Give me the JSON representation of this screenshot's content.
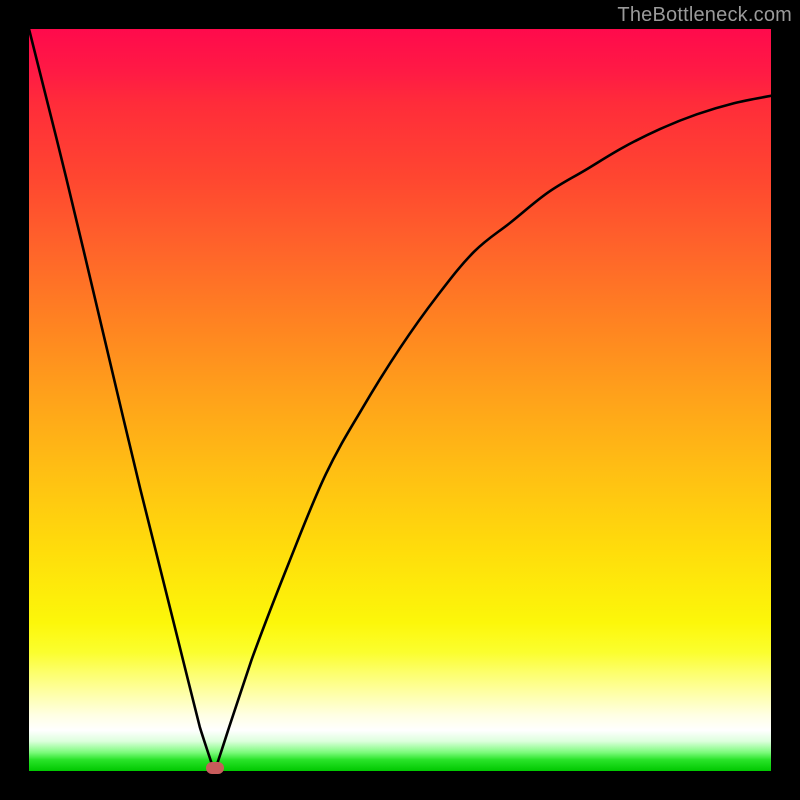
{
  "watermark": {
    "text": "TheBottleneck.com"
  },
  "colors": {
    "frame": "#000000",
    "curve": "#000000",
    "marker": "#c85c5c",
    "gradient_top": "#ff0a4c",
    "gradient_bottom": "#00c800"
  },
  "chart_data": {
    "type": "line",
    "title": "",
    "xlabel": "",
    "ylabel": "",
    "xlim": [
      0,
      100
    ],
    "ylim": [
      0,
      100
    ],
    "series": [
      {
        "name": "bottleneck-curve",
        "x": [
          0,
          5,
          10,
          15,
          20,
          23,
          25,
          27,
          30,
          35,
          40,
          45,
          50,
          55,
          60,
          65,
          70,
          75,
          80,
          85,
          90,
          95,
          100
        ],
        "values": [
          100,
          80,
          59,
          38,
          18,
          6,
          0,
          6,
          15,
          28,
          40,
          49,
          57,
          64,
          70,
          74,
          78,
          81,
          84,
          86.5,
          88.5,
          90,
          91
        ]
      }
    ],
    "marker": {
      "x": 25,
      "y": 0,
      "name": "optimal-point"
    },
    "background": {
      "type": "vertical-gradient",
      "stops": [
        {
          "pos": 0,
          "color": "#ff0a4c"
        },
        {
          "pos": 0.1,
          "color": "#ff2c3a"
        },
        {
          "pos": 0.3,
          "color": "#ff652a"
        },
        {
          "pos": 0.5,
          "color": "#ffa31a"
        },
        {
          "pos": 0.7,
          "color": "#ffdc0b"
        },
        {
          "pos": 0.84,
          "color": "#fbfe2e"
        },
        {
          "pos": 0.9,
          "color": "#feffb1"
        },
        {
          "pos": 0.945,
          "color": "#ffffff"
        },
        {
          "pos": 0.975,
          "color": "#7cfb7c"
        },
        {
          "pos": 1.0,
          "color": "#00c800"
        }
      ]
    }
  }
}
